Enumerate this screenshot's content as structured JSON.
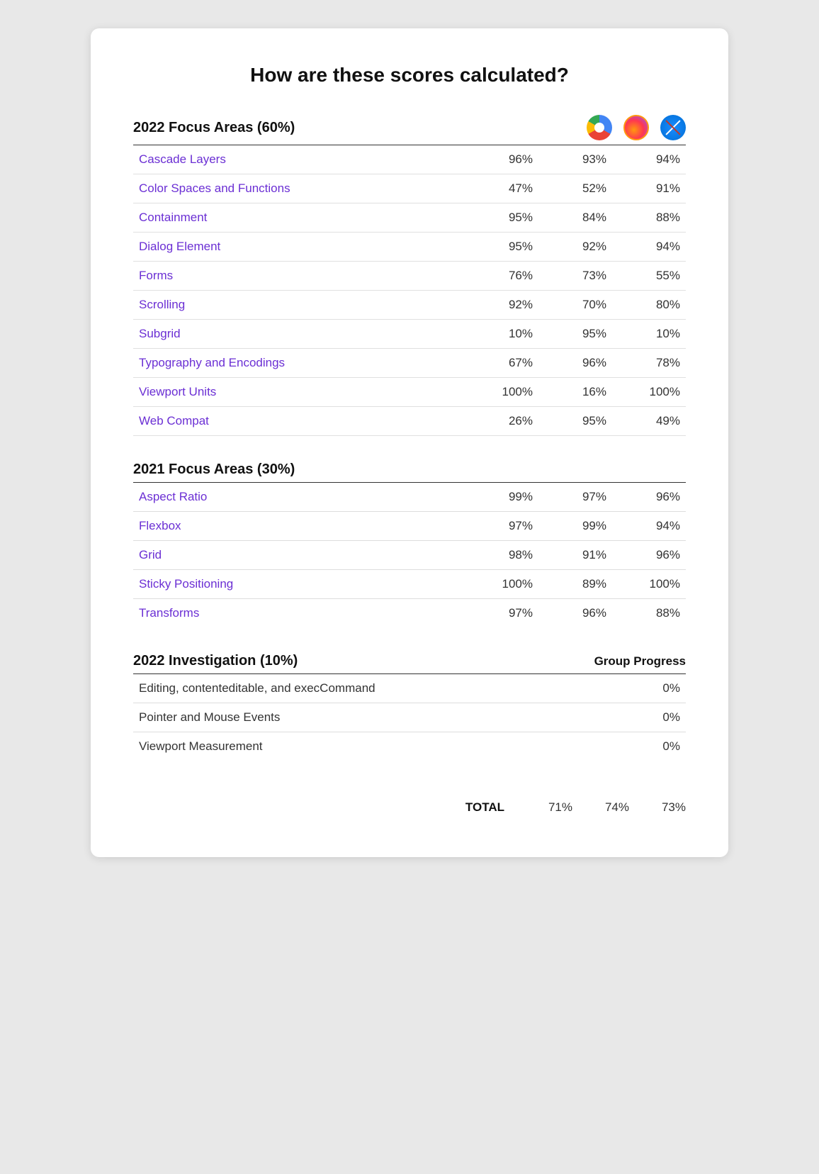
{
  "page": {
    "title": "How are these scores calculated?"
  },
  "browsers": [
    {
      "name": "Chrome Dev",
      "type": "chrome"
    },
    {
      "name": "Firefox",
      "type": "firefox"
    },
    {
      "name": "Safari",
      "type": "safari"
    }
  ],
  "section2022": {
    "label": "2022 Focus Areas (60%)",
    "rows": [
      {
        "label": "Cascade Layers",
        "vals": [
          "96%",
          "93%",
          "94%"
        ]
      },
      {
        "label": "Color Spaces and Functions",
        "vals": [
          "47%",
          "52%",
          "91%"
        ]
      },
      {
        "label": "Containment",
        "vals": [
          "95%",
          "84%",
          "88%"
        ]
      },
      {
        "label": "Dialog Element",
        "vals": [
          "95%",
          "92%",
          "94%"
        ]
      },
      {
        "label": "Forms",
        "vals": [
          "76%",
          "73%",
          "55%"
        ]
      },
      {
        "label": "Scrolling",
        "vals": [
          "92%",
          "70%",
          "80%"
        ]
      },
      {
        "label": "Subgrid",
        "vals": [
          "10%",
          "95%",
          "10%"
        ]
      },
      {
        "label": "Typography and Encodings",
        "vals": [
          "67%",
          "96%",
          "78%"
        ]
      },
      {
        "label": "Viewport Units",
        "vals": [
          "100%",
          "16%",
          "100%"
        ]
      },
      {
        "label": "Web Compat",
        "vals": [
          "26%",
          "95%",
          "49%"
        ]
      }
    ]
  },
  "section2021": {
    "label": "2021 Focus Areas (30%)",
    "rows": [
      {
        "label": "Aspect Ratio",
        "vals": [
          "99%",
          "97%",
          "96%"
        ]
      },
      {
        "label": "Flexbox",
        "vals": [
          "97%",
          "99%",
          "94%"
        ]
      },
      {
        "label": "Grid",
        "vals": [
          "98%",
          "91%",
          "96%"
        ]
      },
      {
        "label": "Sticky Positioning",
        "vals": [
          "100%",
          "89%",
          "100%"
        ]
      },
      {
        "label": "Transforms",
        "vals": [
          "97%",
          "96%",
          "88%"
        ]
      }
    ]
  },
  "sectionInvestigation": {
    "label": "2022 Investigation (10%)",
    "groupProgressLabel": "Group Progress",
    "rows": [
      {
        "label": "Editing, contenteditable, and execCommand",
        "val": "0%"
      },
      {
        "label": "Pointer and Mouse Events",
        "val": "0%"
      },
      {
        "label": "Viewport Measurement",
        "val": "0%"
      }
    ]
  },
  "totals": {
    "label": "TOTAL",
    "vals": [
      "71%",
      "74%",
      "73%"
    ]
  }
}
